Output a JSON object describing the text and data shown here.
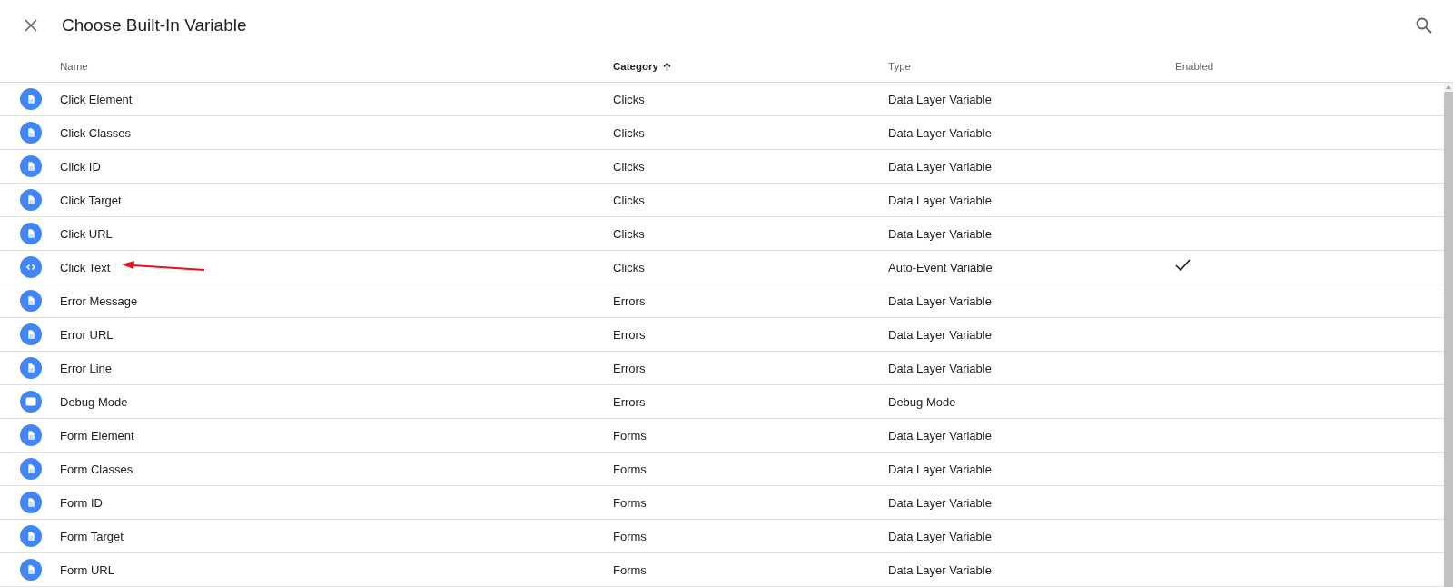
{
  "header": {
    "title": "Choose Built-In Variable"
  },
  "table": {
    "columns": [
      {
        "label": "Name",
        "sorted": false
      },
      {
        "label": "Category",
        "sorted": true
      },
      {
        "label": "Type",
        "sorted": false
      },
      {
        "label": "Enabled",
        "sorted": false
      }
    ],
    "rows": [
      {
        "kind": "document",
        "name": "Click Element",
        "category": "Clicks",
        "type": "Data Layer Variable",
        "enabled": false,
        "annotated": false
      },
      {
        "kind": "document",
        "name": "Click Classes",
        "category": "Clicks",
        "type": "Data Layer Variable",
        "enabled": false,
        "annotated": false
      },
      {
        "kind": "document",
        "name": "Click ID",
        "category": "Clicks",
        "type": "Data Layer Variable",
        "enabled": false,
        "annotated": false
      },
      {
        "kind": "document",
        "name": "Click Target",
        "category": "Clicks",
        "type": "Data Layer Variable",
        "enabled": false,
        "annotated": false
      },
      {
        "kind": "document",
        "name": "Click URL",
        "category": "Clicks",
        "type": "Data Layer Variable",
        "enabled": false,
        "annotated": false
      },
      {
        "kind": "code",
        "name": "Click Text",
        "category": "Clicks",
        "type": "Auto-Event Variable",
        "enabled": true,
        "annotated": true
      },
      {
        "kind": "document",
        "name": "Error Message",
        "category": "Errors",
        "type": "Data Layer Variable",
        "enabled": false,
        "annotated": false
      },
      {
        "kind": "document",
        "name": "Error URL",
        "category": "Errors",
        "type": "Data Layer Variable",
        "enabled": false,
        "annotated": false
      },
      {
        "kind": "document",
        "name": "Error Line",
        "category": "Errors",
        "type": "Data Layer Variable",
        "enabled": false,
        "annotated": false
      },
      {
        "kind": "window",
        "name": "Debug Mode",
        "category": "Errors",
        "type": "Debug Mode",
        "enabled": false,
        "annotated": false
      },
      {
        "kind": "document",
        "name": "Form Element",
        "category": "Forms",
        "type": "Data Layer Variable",
        "enabled": false,
        "annotated": false
      },
      {
        "kind": "document",
        "name": "Form Classes",
        "category": "Forms",
        "type": "Data Layer Variable",
        "enabled": false,
        "annotated": false
      },
      {
        "kind": "document",
        "name": "Form ID",
        "category": "Forms",
        "type": "Data Layer Variable",
        "enabled": false,
        "annotated": false
      },
      {
        "kind": "document",
        "name": "Form Target",
        "category": "Forms",
        "type": "Data Layer Variable",
        "enabled": false,
        "annotated": false
      },
      {
        "kind": "document",
        "name": "Form URL",
        "category": "Forms",
        "type": "Data Layer Variable",
        "enabled": false,
        "annotated": false
      }
    ]
  }
}
